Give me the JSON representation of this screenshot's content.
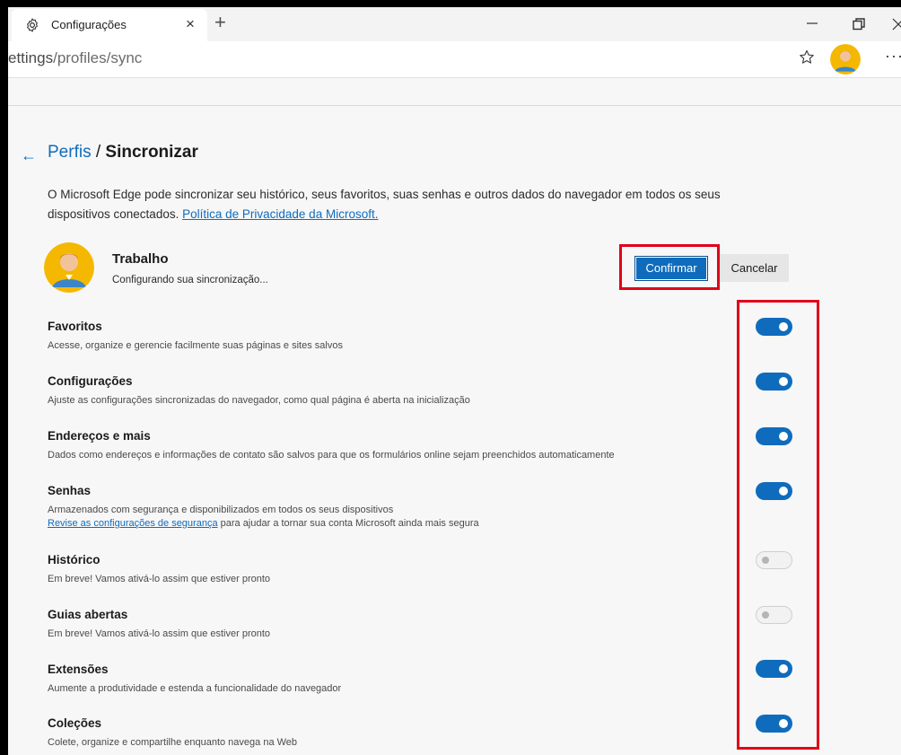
{
  "browser": {
    "tab_title": "Configurações",
    "tab_close": "×",
    "new_tab": "+",
    "url_prefix": "ettings",
    "url_path": "/profiles/sync",
    "more": "···"
  },
  "header": {
    "crumb": "Perfis",
    "separator": "/",
    "title": "Sincronizar"
  },
  "intro": {
    "text": "O Microsoft Edge pode sincronizar seu histórico, seus favoritos, suas senhas e outros dados do navegador em todos os seus dispositivos conectados.",
    "link": "Política de Privacidade da Microsoft."
  },
  "profile": {
    "name": "Trabalho",
    "status": "Configurando sua sincronização..."
  },
  "actions": {
    "confirm": "Confirmar",
    "cancel": "Cancelar"
  },
  "items": [
    {
      "title": "Favoritos",
      "desc": "Acesse, organize e gerencie facilmente suas páginas e sites salvos",
      "on": true
    },
    {
      "title": "Configurações",
      "desc": "Ajuste as configurações sincronizadas do navegador, como qual página é aberta na inicialização",
      "on": true
    },
    {
      "title": "Endereços e mais",
      "desc": "Dados como endereços e informações de contato são salvos para que os formulários online sejam preenchidos automaticamente",
      "on": true
    },
    {
      "title": "Senhas",
      "desc": "Armazenados com segurança e disponibilizados em todos os seus dispositivos",
      "link": "Revise as configurações de segurança",
      "link_suffix": " para ajudar a tornar sua conta Microsoft ainda mais segura",
      "on": true
    },
    {
      "title": "Histórico",
      "desc": "Em breve! Vamos ativá-lo assim que estiver pronto",
      "on": false
    },
    {
      "title": "Guias abertas",
      "desc": "Em breve! Vamos ativá-lo assim que estiver pronto",
      "on": false
    },
    {
      "title": "Extensões",
      "desc": "Aumente a produtividade e estenda a funcionalidade do navegador",
      "on": true
    },
    {
      "title": "Coleções",
      "desc": "Colete, organize e compartilhe enquanto navega na Web",
      "on": true
    }
  ],
  "colors": {
    "accent": "#0f6cbd",
    "highlight": "#e0001b"
  }
}
